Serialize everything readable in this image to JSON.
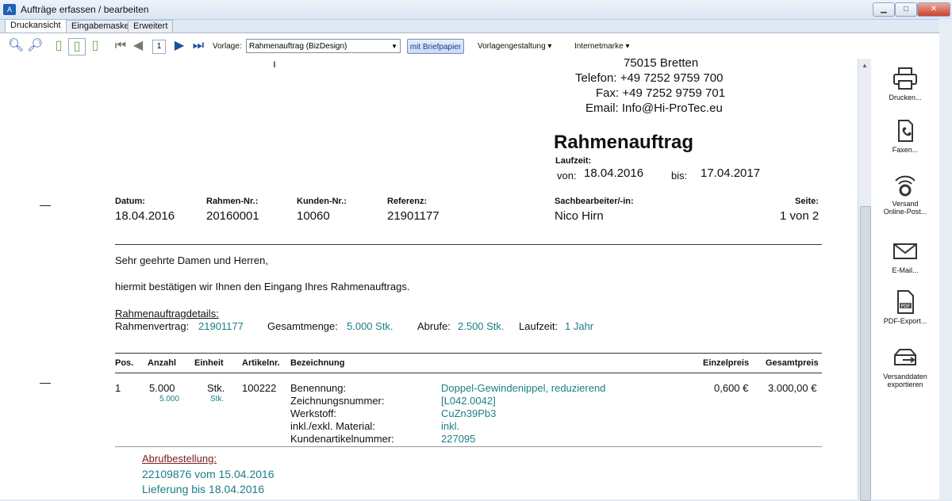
{
  "window": {
    "title": "Aufträge erfassen / bearbeiten",
    "icon_label": "A"
  },
  "tabs": [
    "Druckansicht",
    "Eingabemaske",
    "Erweitert"
  ],
  "toolbar": {
    "page": "1",
    "vorlage_label": "Vorlage:",
    "vorlage_value": "Rahmenauftrag (BizDesign)",
    "briefpapier": "mit Briefpapier",
    "vorlagengestaltung": "Vorlagengestaltung",
    "internetmarke": "Internetmarke"
  },
  "side": {
    "print": "Drucken...",
    "fax": "Faxen...",
    "online_post_1": "Versand",
    "online_post_2": "Online-Post...",
    "email": "E-Mail...",
    "pdf": "PDF-Export...",
    "export_1": "Versanddaten",
    "export_2": "exportieren"
  },
  "doc": {
    "sender": {
      "city": "75015 Bretten",
      "phone": "Telefon: +49 7252 9759 700",
      "fax": "Fax: +49 7252 9759 701",
      "email": "Email: Info@Hi-ProTec.eu"
    },
    "title": "Rahmenauftrag",
    "laufzeit_label": "Laufzeit:",
    "von_label": "von:",
    "von": "18.04.2016",
    "bis_label": "bis:",
    "bis": "17.04.2017",
    "meta_labels": {
      "datum": "Datum:",
      "rahmen": "Rahmen-Nr.:",
      "kunde": "Kunden-Nr.:",
      "referenz": "Referenz:",
      "sachbearbeiter": "Sachbearbeiter/-in:",
      "seite": "Seite:"
    },
    "meta_values": {
      "datum": "18.04.2016",
      "rahmen": "20160001",
      "kunde": "10060",
      "referenz": "21901177",
      "sachbearbeiter": "Nico Hirn",
      "seite": "1 von 2"
    },
    "greeting": "Sehr geehrte Damen und Herren,",
    "intro": "hiermit bestätigen wir Ihnen den Eingang Ihres Rahmenauftrags.",
    "details_title": "Rahmenauftragdetails:",
    "details": {
      "vertrag_label": "Rahmenvertrag:",
      "vertrag": "21901177",
      "menge_label": "Gesamtmenge:",
      "menge": "5.000 Stk.",
      "abrufe_label": "Abrufe:",
      "abrufe": "2.500 Stk.",
      "laufzeit_label": "Laufzeit:",
      "laufzeit": "1 Jahr"
    },
    "table_headers": {
      "pos": "Pos.",
      "anzahl": "Anzahl",
      "einheit": "Einheit",
      "artikel": "Artikelnr.",
      "bezeichnung": "Bezeichnung",
      "einzelpreis": "Einzelpreis",
      "gesamtpreis": "Gesamtpreis"
    },
    "row": {
      "pos": "1",
      "anzahl": "5.000",
      "anzahl_sub": "5.000",
      "einheit": "Stk.",
      "einheit_sub": "Stk.",
      "artikel": "100222",
      "einzelpreis": "0,600 €",
      "gesamtpreis": "3.000,00 €",
      "attrs": [
        {
          "label": "Benennung:",
          "value": "Doppel-Gewindenippel, reduzierend"
        },
        {
          "label": "Zeichnungsnummer:",
          "value": "[L042.0042]"
        },
        {
          "label": "Werkstoff:",
          "value": "CuZn39Pb3"
        },
        {
          "label": "inkl./exkl. Material:",
          "value": "inkl."
        },
        {
          "label": "Kundenartikelnummer:",
          "value": "227095"
        }
      ]
    },
    "abruf": {
      "title": "Abrufbestellung:",
      "line1": "22109876 vom 15.04.2016",
      "line2": "Lieferung bis 18.04.2016"
    }
  }
}
